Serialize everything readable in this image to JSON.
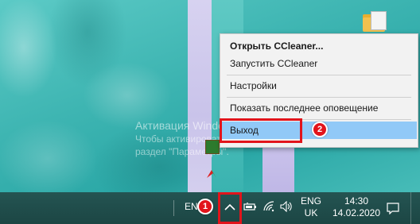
{
  "desktop": {
    "activation_title": "Активация Windows",
    "activation_line1": "Чтобы активировать Windows, перейдите в",
    "activation_line2": "раздел \"Параметры\"."
  },
  "context_menu": {
    "items": [
      {
        "label": "Открыть CCleaner...",
        "bold": true
      },
      {
        "label": "Запустить CCleaner"
      },
      {
        "label": "Настройки"
      },
      {
        "label": "Показать последнее оповещение"
      },
      {
        "label": "Выход",
        "highlighted": true
      }
    ]
  },
  "annotations": {
    "badge1": "1",
    "badge2": "2",
    "color": "#e2141b"
  },
  "taskbar": {
    "lang_left": "EN",
    "chevron_icon": "chevron-up-icon",
    "tray_icons": [
      "battery-icon",
      "wifi-icon",
      "volume-icon"
    ],
    "language": {
      "line1": "ENG",
      "line2": "UK"
    },
    "clock": {
      "time": "14:30",
      "date": "14.02.2020"
    },
    "notification_icon": "action-center-icon"
  },
  "colors": {
    "taskbar": "#1f4a48",
    "menu_bg": "#f2f2f2",
    "menu_highlight": "#91c9f7"
  }
}
